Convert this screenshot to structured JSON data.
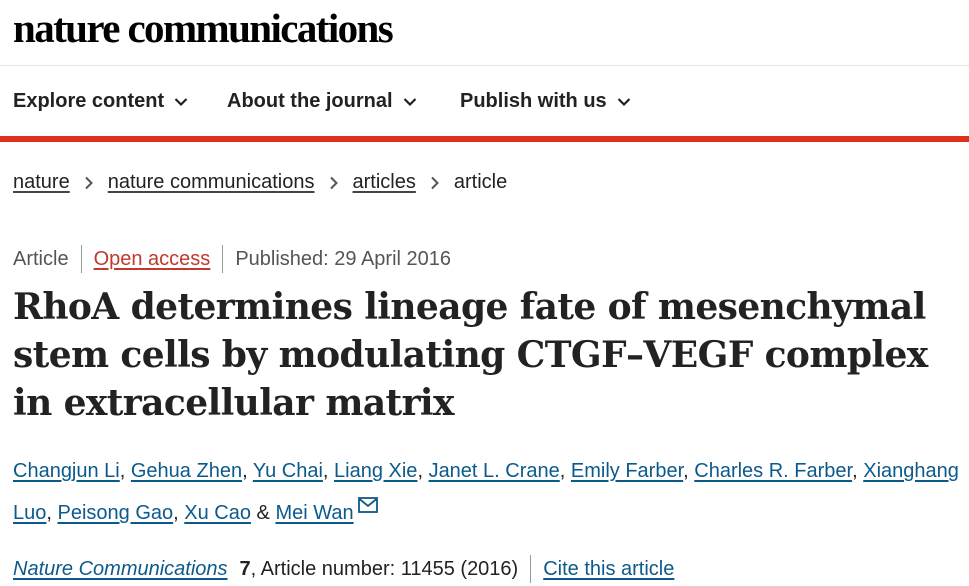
{
  "header": {
    "brand": "nature communications"
  },
  "nav": {
    "items": [
      {
        "label": "Explore content"
      },
      {
        "label": "About the journal"
      },
      {
        "label": "Publish with us"
      }
    ]
  },
  "breadcrumb": {
    "items": [
      "nature",
      "nature communications",
      "articles"
    ],
    "current": "article"
  },
  "meta": {
    "type": "Article",
    "access": "Open access",
    "published": "Published: 29 April 2016"
  },
  "title": "RhoA determines lineage fate of mesenchymal stem cells by modulating CTGF–VEGF complex in extracellular matrix",
  "authors": {
    "list": [
      "Changjun Li",
      "Gehua Zhen",
      "Yu Chai",
      "Liang Xie",
      "Janet L. Crane",
      "Emily Farber",
      "Charles R. Farber",
      "Xianghang Luo",
      "Peisong Gao",
      "Xu Cao"
    ],
    "conjunction": "&",
    "last": "Mei Wan"
  },
  "citation": {
    "journal": "Nature Communications",
    "volume": "7",
    "rest": ", Article number: 11455 (2016)",
    "cite_label": "Cite this article"
  },
  "colors": {
    "accent_red": "#e0301e",
    "link_blue": "#0c5a8c",
    "open_access": "#c0392b"
  }
}
